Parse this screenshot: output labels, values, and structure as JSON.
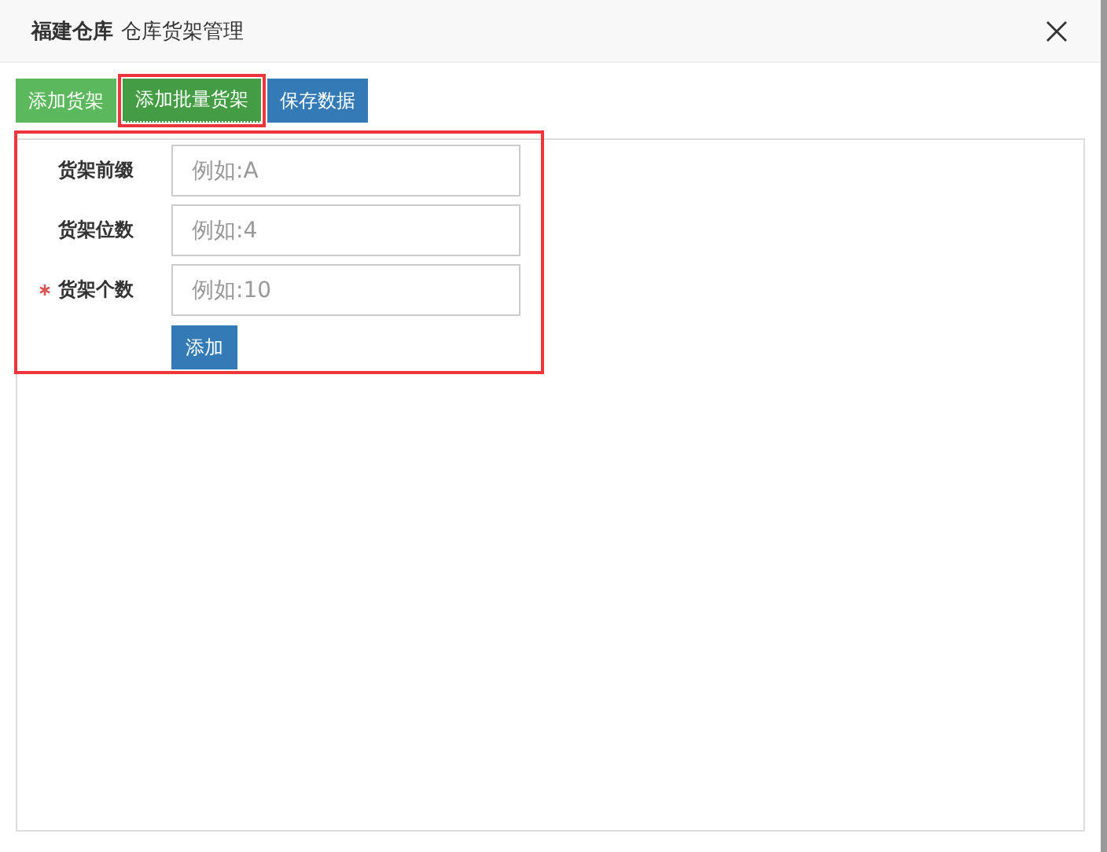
{
  "window": {
    "title_bold": "福建仓库",
    "title": "仓库货架管理"
  },
  "toolbar": [
    {
      "label": "添加货架",
      "kind": "success",
      "selected": false
    },
    {
      "label": "添加批量货架",
      "kind": "success",
      "selected": true
    },
    {
      "label": "保存数据",
      "kind": "primary",
      "selected": false
    }
  ],
  "form": {
    "highlighted": true,
    "fields": [
      {
        "label": "货架前缀",
        "placeholder": "例如:A",
        "required": false
      },
      {
        "label": "货架位数",
        "placeholder": "例如:4",
        "required": false
      },
      {
        "label": "货架个数",
        "placeholder": "例如:10",
        "required": true
      }
    ],
    "submit": "添加"
  }
}
